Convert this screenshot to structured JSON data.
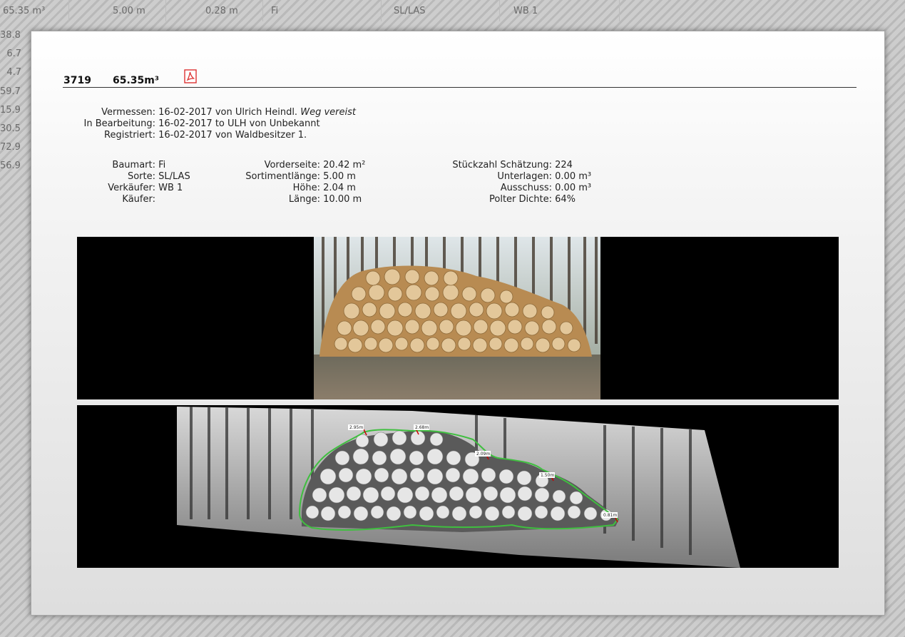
{
  "background_table": {
    "row": [
      "65.35 m³",
      "5.00 m",
      "0.28 m",
      "Fi",
      "SL/LAS",
      "WB 1"
    ],
    "column_values": [
      "38.8",
      "6.7",
      "4.7",
      "59.7",
      "15.9",
      "30.5",
      "72.9",
      "56.9"
    ]
  },
  "record": {
    "id": "3719",
    "volume": "65.35m³",
    "pdf_icon": "pdf-icon",
    "status": [
      {
        "label": "Vermessen:",
        "value": "16-02-2017 von Ulrich Heindl.",
        "note": "Weg vereist"
      },
      {
        "label": "In Bearbeitung:",
        "value": "16-02-2017 to ULH von Unbekannt",
        "note": ""
      },
      {
        "label": "Registriert:",
        "value": "16-02-2017 von Waldbesitzer 1.",
        "note": ""
      }
    ],
    "details_col1": [
      {
        "label": "Baumart:",
        "value": "Fi"
      },
      {
        "label": "Sorte:",
        "value": "SL/LAS"
      },
      {
        "label": "Verkäufer:",
        "value": "WB 1"
      },
      {
        "label": "Käufer:",
        "value": ""
      }
    ],
    "details_col2": [
      {
        "label": "Vorderseite:",
        "value": "20.42 m²"
      },
      {
        "label": "Sortimentlänge:",
        "value": "5.00 m"
      },
      {
        "label": "Höhe:",
        "value": "2.04 m"
      },
      {
        "label": "Länge:",
        "value": "10.00 m"
      }
    ],
    "details_col3": [
      {
        "label": "Stückzahl Schätzung:",
        "value": "224"
      },
      {
        "label": "Unterlagen:",
        "value": "0.00 m³"
      },
      {
        "label": "Ausschuss:",
        "value": "0.00 m³"
      },
      {
        "label": "Polter Dichte:",
        "value": "64%"
      }
    ],
    "measure_labels": [
      "2.95m",
      "2.68m",
      "2.09m",
      "1.50m",
      "0.81m"
    ]
  }
}
